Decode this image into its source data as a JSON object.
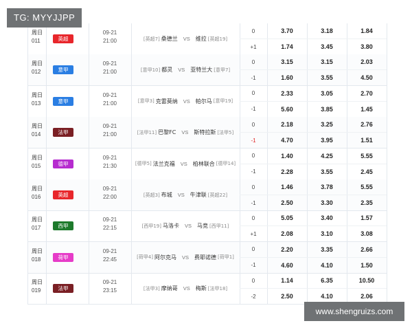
{
  "tg_label": "TG: MYYJJPP",
  "watermark": "www.shengruizs.com",
  "matches": [
    {
      "week": "周日",
      "num": "011",
      "league": "英超",
      "league_color": "#e8262b",
      "date": "09-21",
      "time": "21:00",
      "home_rank": "[英超7]",
      "home": "桑德兰",
      "vs": "VS",
      "away": "维拉",
      "away_rank": "[英超19]",
      "hc_top": "0",
      "hc_bot": "+1",
      "hc_bot_red": false,
      "odds_top": [
        "3.70",
        "3.18",
        "1.84"
      ],
      "odds_bot": [
        "1.74",
        "3.45",
        "3.80"
      ]
    },
    {
      "week": "周日",
      "num": "012",
      "league": "意甲",
      "league_color": "#2a7ee3",
      "date": "09-21",
      "time": "21:00",
      "home_rank": "[意甲10]",
      "home": "都灵",
      "vs": "VS",
      "away": "亚特兰大",
      "away_rank": "[意甲7]",
      "hc_top": "0",
      "hc_bot": "-1",
      "hc_bot_red": false,
      "odds_top": [
        "3.15",
        "3.15",
        "2.03"
      ],
      "odds_bot": [
        "1.60",
        "3.55",
        "4.50"
      ]
    },
    {
      "week": "周日",
      "num": "013",
      "league": "意甲",
      "league_color": "#2a7ee3",
      "date": "09-21",
      "time": "21:00",
      "home_rank": "[意甲3]",
      "home": "克雷莫纳",
      "vs": "VS",
      "away": "帕尔马",
      "away_rank": "[意甲19]",
      "hc_top": "0",
      "hc_bot": "-1",
      "hc_bot_red": false,
      "odds_top": [
        "2.33",
        "3.05",
        "2.70"
      ],
      "odds_bot": [
        "5.60",
        "3.85",
        "1.45"
      ]
    },
    {
      "week": "周日",
      "num": "014",
      "league": "法甲",
      "league_color": "#7a1f24",
      "date": "09-21",
      "time": "21:00",
      "home_rank": "[法甲11]",
      "home": "巴黎FC",
      "vs": "VS",
      "away": "斯特拉斯",
      "away_rank": "[法甲5]",
      "hc_top": "0",
      "hc_bot": "-1",
      "hc_bot_red": true,
      "odds_top": [
        "2.18",
        "3.25",
        "2.76"
      ],
      "odds_bot": [
        "4.70",
        "3.95",
        "1.51"
      ]
    },
    {
      "week": "周日",
      "num": "015",
      "league": "德甲",
      "league_color": "#b62ccf",
      "date": "09-21",
      "time": "21:30",
      "home_rank": "[德甲5]",
      "home": "法兰克福",
      "vs": "VS",
      "away": "柏林联合",
      "away_rank": "[德甲14]",
      "hc_top": "0",
      "hc_bot": "-1",
      "hc_bot_red": false,
      "odds_top": [
        "1.40",
        "4.25",
        "5.55"
      ],
      "odds_bot": [
        "2.28",
        "3.55",
        "2.45"
      ]
    },
    {
      "week": "周日",
      "num": "016",
      "league": "英超",
      "league_color": "#e8262b",
      "date": "09-21",
      "time": "22:00",
      "home_rank": "[英超3]",
      "home": "布城",
      "vs": "VS",
      "away": "牛津联",
      "away_rank": "[英超22]",
      "hc_top": "0",
      "hc_bot": "-1",
      "hc_bot_red": false,
      "odds_top": [
        "1.46",
        "3.78",
        "5.55"
      ],
      "odds_bot": [
        "2.50",
        "3.30",
        "2.35"
      ]
    },
    {
      "week": "周日",
      "num": "017",
      "league": "西甲",
      "league_color": "#1d7a2c",
      "date": "09-21",
      "time": "22:15",
      "home_rank": "[西甲19]",
      "home": "马洛卡",
      "vs": "VS",
      "away": "马竞",
      "away_rank": "[西甲11]",
      "hc_top": "0",
      "hc_bot": "+1",
      "hc_bot_red": false,
      "odds_top": [
        "5.05",
        "3.40",
        "1.57"
      ],
      "odds_bot": [
        "2.08",
        "3.10",
        "3.08"
      ]
    },
    {
      "week": "周日",
      "num": "018",
      "league": "荷甲",
      "league_color": "#e63cc8",
      "date": "09-21",
      "time": "22:45",
      "home_rank": "[荷甲4]",
      "home": "阿尔克马",
      "vs": "VS",
      "away": "费耶诺德",
      "away_rank": "[荷甲1]",
      "hc_top": "0",
      "hc_bot": "-1",
      "hc_bot_red": false,
      "odds_top": [
        "2.20",
        "3.35",
        "2.66"
      ],
      "odds_bot": [
        "4.60",
        "4.10",
        "1.50"
      ]
    },
    {
      "week": "周日",
      "num": "019",
      "league": "法甲",
      "league_color": "#7a1f24",
      "date": "09-21",
      "time": "23:15",
      "home_rank": "[法甲3]",
      "home": "摩纳哥",
      "vs": "VS",
      "away": "梅斯",
      "away_rank": "[法甲18]",
      "hc_top": "0",
      "hc_bot": "-2",
      "hc_bot_red": false,
      "odds_top": [
        "1.14",
        "6.35",
        "10.50"
      ],
      "odds_bot": [
        "2.50",
        "4.10",
        "2.06"
      ]
    }
  ]
}
